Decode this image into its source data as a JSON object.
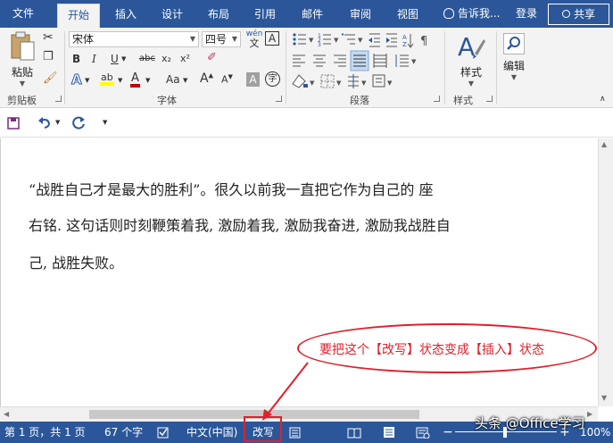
{
  "tabs": {
    "file": "文件",
    "items": [
      "开始",
      "插入",
      "设计",
      "布局",
      "引用",
      "邮件",
      "审阅",
      "视图"
    ],
    "active": "开始",
    "tell_me": "告诉我...",
    "login": "登录",
    "share": "共享"
  },
  "ribbon": {
    "clipboard": {
      "paste_label": "粘贴",
      "group_label": "剪贴板"
    },
    "font": {
      "font_name": "宋体",
      "font_size": "四号",
      "wen_icon": "wén",
      "wen_char": "文",
      "a_box": "A",
      "bold": "B",
      "italic": "I",
      "underline": "U",
      "strike": "abc",
      "subscript": "x₂",
      "superscript": "x²",
      "text_effects": "A",
      "highlight": "ab",
      "font_color": "A",
      "aa": "Aa",
      "grow": "A",
      "shrink": "A",
      "char_shading": "A",
      "enclose": "字",
      "group_label": "字体"
    },
    "paragraph": {
      "group_label": "段落"
    },
    "styles": {
      "label": "样式",
      "group_label": "样式"
    },
    "editing": {
      "label": "编辑"
    }
  },
  "document": {
    "lines": [
      "“战胜自己才是最大的胜利”。很久以前我一直把它作为自己的  座",
      "右铭.  这句话则时刻鞭策着我, 激励着我, 激励我奋进, 激励我战胜自",
      "己, 战胜失败。"
    ]
  },
  "annotation": {
    "callout": "要把这个【改写】状态变成【插入】状态"
  },
  "status": {
    "page": "第 1 页，共 1 页",
    "words": "67 个字",
    "language": "中文(中国)",
    "mode": "改写",
    "zoom": "100%"
  },
  "watermark": "头条 @Office学习",
  "colors": {
    "brand": "#2b579a",
    "highlight": "#ffff00",
    "font_color": "#c00000",
    "annotation": "#e0202a"
  }
}
